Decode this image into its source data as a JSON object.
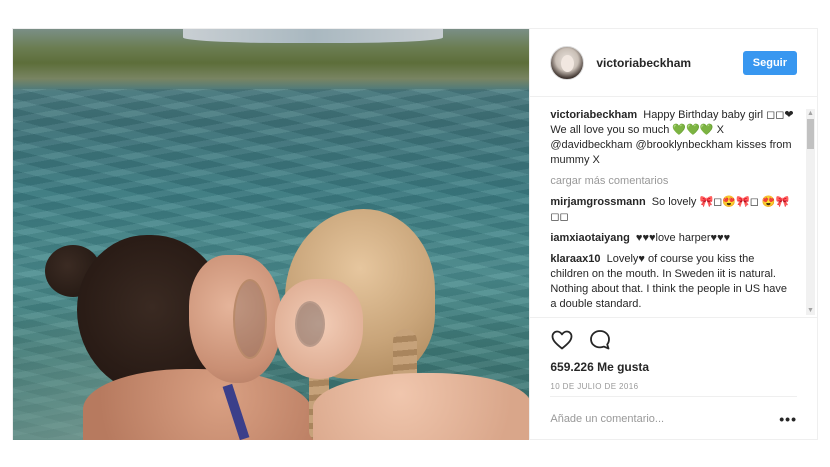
{
  "header": {
    "username": "victoriabeckham",
    "follow_label": "Seguir"
  },
  "caption": {
    "username": "victoriabeckham",
    "text": "Happy Birthday baby girl ◻◻❤ We all love you so much 💚💚💚 X @davidbeckham @brooklynbeckham kisses from mummy X"
  },
  "load_more": "cargar más comentarios",
  "comments": [
    {
      "username": "mirjamgrossmann",
      "text": "So lovely 🎀◻😍🎀◻ 😍🎀 ◻◻"
    },
    {
      "username": "iamxiaotaiyang",
      "text": "♥♥♥love harper♥♥♥"
    },
    {
      "username": "klaraax10",
      "text": "Lovely♥ of course you kiss the children on the mouth. In Sweden iit is natural. Nothing about that. I think the people in US have a double standard."
    }
  ],
  "actions": {
    "like_icon": "heart-outline-icon",
    "comment_icon": "speech-bubble-icon",
    "likes": "659.226 Me gusta",
    "date": "10 DE JULIO DE 2016"
  },
  "add_comment": {
    "placeholder": "Añade un comentario...",
    "more_label": "•••"
  }
}
